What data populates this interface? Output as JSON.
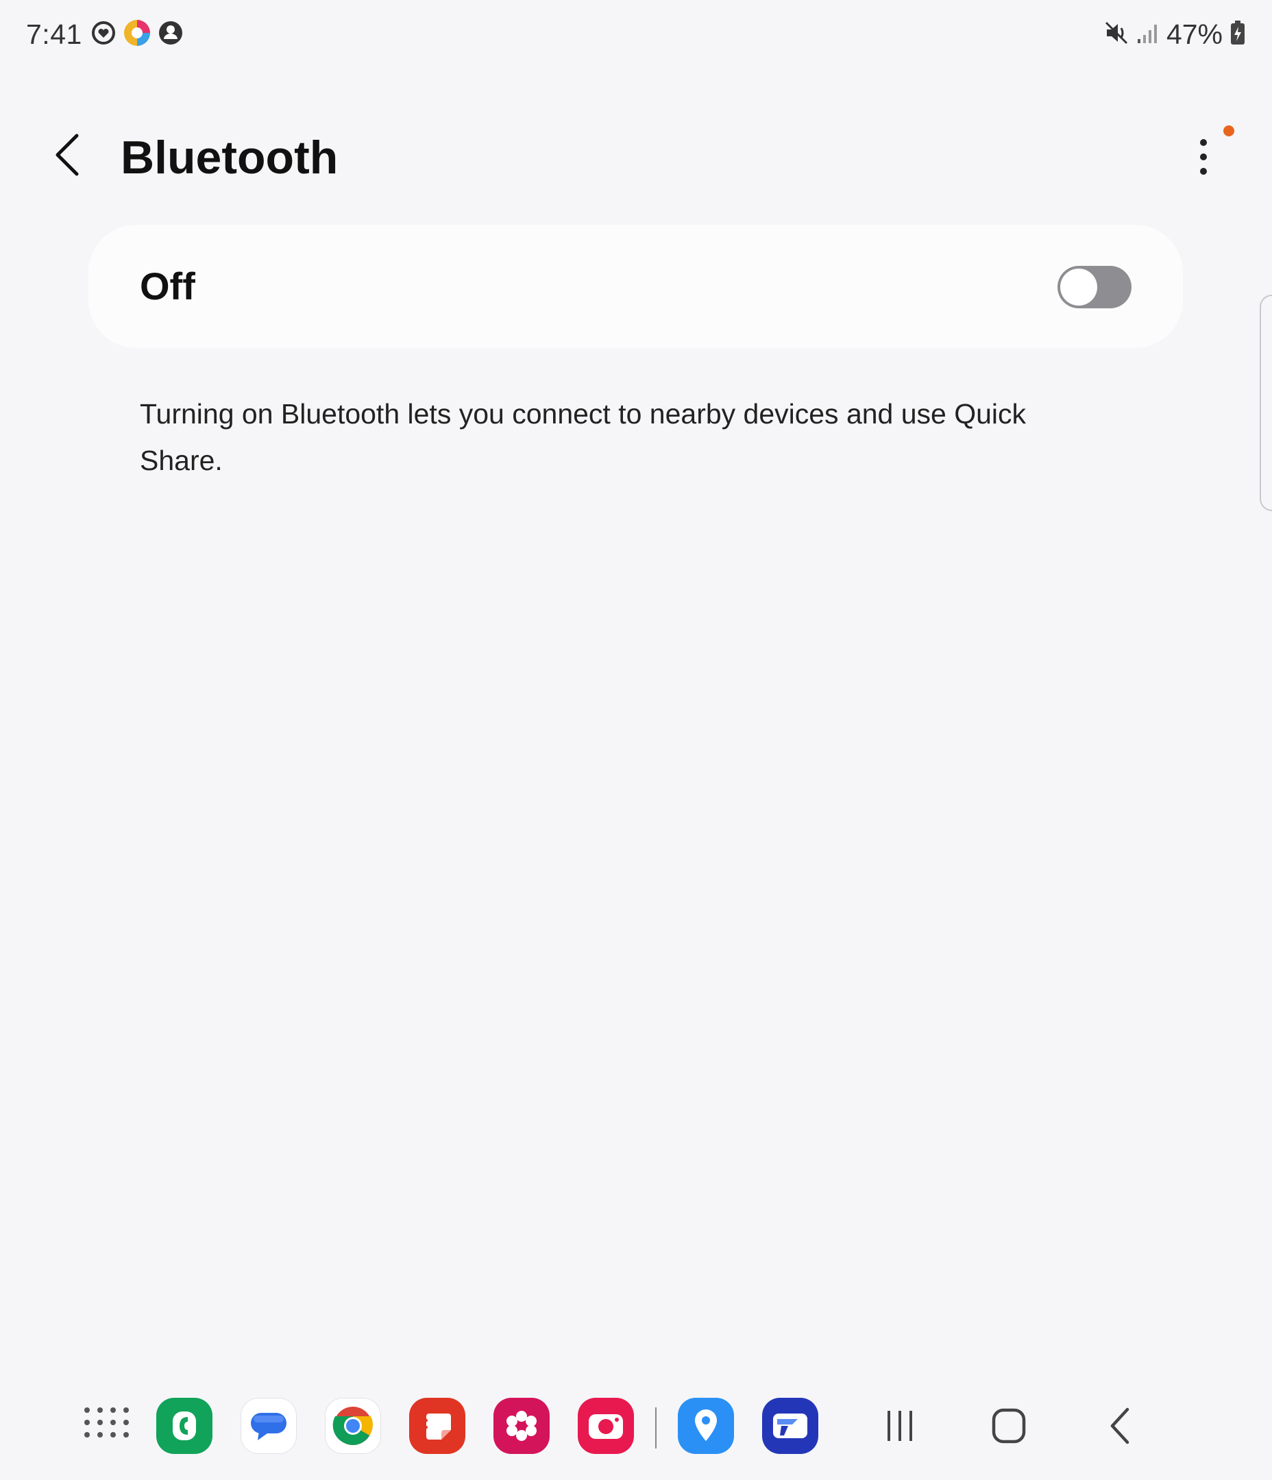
{
  "status_bar": {
    "time": "7:41",
    "battery_percent": "47%",
    "left_icons": [
      "smart-things-icon",
      "app-notification-icon",
      "account-icon"
    ],
    "right_icons": [
      "mute-icon",
      "signal-icon",
      "battery-charging-icon"
    ]
  },
  "header": {
    "title": "Bluetooth",
    "back_icon": "back-arrow-icon",
    "more_icon": "more-options-icon",
    "notification_dot_color": "#e8651e"
  },
  "toggle": {
    "label": "Off",
    "state": "off"
  },
  "description": "Turning on Bluetooth lets you connect to nearby devices and use Quick Share.",
  "dock": {
    "apps": [
      {
        "name": "apps-grid-icon"
      },
      {
        "name": "phone-app-icon",
        "color": "#11a35a"
      },
      {
        "name": "messages-app-icon",
        "color": "#2f6fe8"
      },
      {
        "name": "chrome-app-icon"
      },
      {
        "name": "notes-app-icon",
        "color": "#e03524"
      },
      {
        "name": "gallery-app-icon",
        "color": "#d4145a"
      },
      {
        "name": "camera-app-icon",
        "color": "#e8194f"
      },
      {
        "name": "maps-app-icon",
        "color": "#2b90f5"
      },
      {
        "name": "files-app-icon",
        "color": "#2436b8"
      }
    ],
    "nav": [
      "recents-icon",
      "home-icon",
      "back-icon"
    ]
  }
}
